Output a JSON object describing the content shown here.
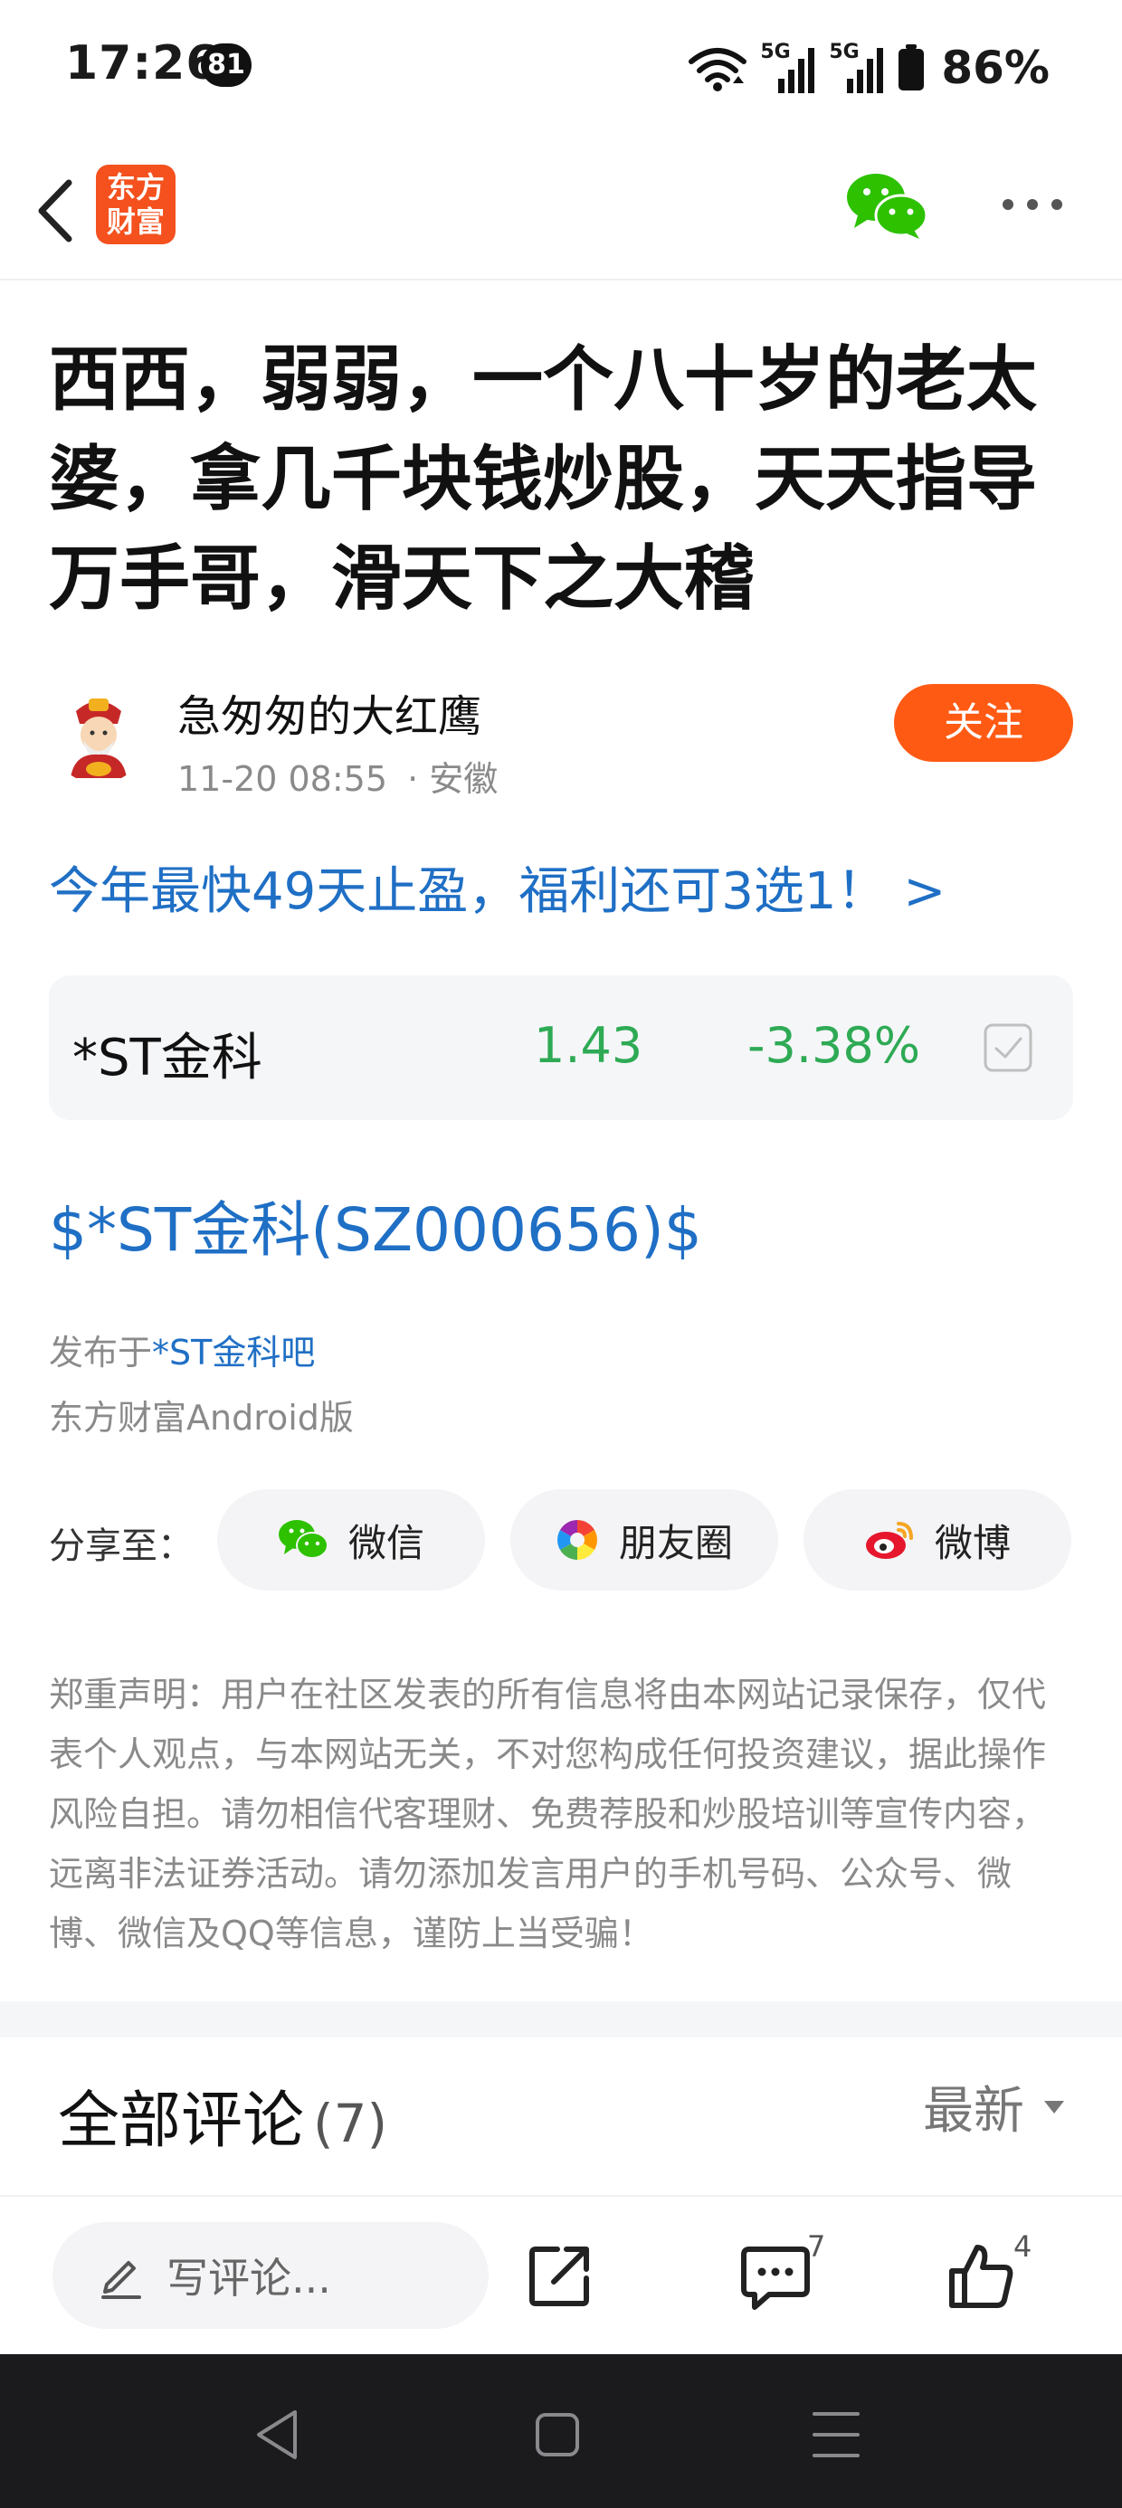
{
  "status_bar": {
    "time": "17:26",
    "notification_count": "81",
    "network_1": "5G",
    "network_2": "5G",
    "battery": "86%"
  },
  "nav": {
    "logo_line1": "东方",
    "logo_line2": "财富"
  },
  "post": {
    "title": "西西，弱弱，一个八十岁的老太婆，拿几千块钱炒股，天天指导万手哥，滑天下之大稽",
    "author": "急匆匆的大红鹰",
    "date": "11-20 08:55",
    "location": "· 安徽",
    "follow_label": "关注",
    "promo_link": "今年最快49天止盈，福利还可3选1！ >",
    "stock": {
      "name": "*ST金科",
      "price": "1.43",
      "change": "-3.38%"
    },
    "stock_tag": "$*ST金科(SZ000656)$",
    "published_prefix": "发布于",
    "published_bar": "*ST金科吧",
    "client": "东方财富Android版"
  },
  "share": {
    "label": "分享至：",
    "wechat": "微信",
    "moments": "朋友圈",
    "weibo": "微博"
  },
  "disclaimer": "郑重声明：用户在社区发表的所有信息将由本网站记录保存，仅代表个人观点，与本网站无关，不对您构成任何投资建议，据此操作风险自担。请勿相信代客理财、免费荐股和炒股培训等宣传内容，远离非法证券活动。请勿添加发言用户的手机号码、公众号、微博、微信及QQ等信息，谨防上当受骗！",
  "comments": {
    "title": "全部评论",
    "count": "(7)",
    "sort_label": "最新"
  },
  "action_bar": {
    "input_placeholder": "写评论...",
    "comment_count": "7",
    "like_count": "4"
  },
  "colors": {
    "brand_orange": "#ff5a14",
    "link_blue": "#1f6fc5",
    "stock_green": "#2eaa55"
  }
}
